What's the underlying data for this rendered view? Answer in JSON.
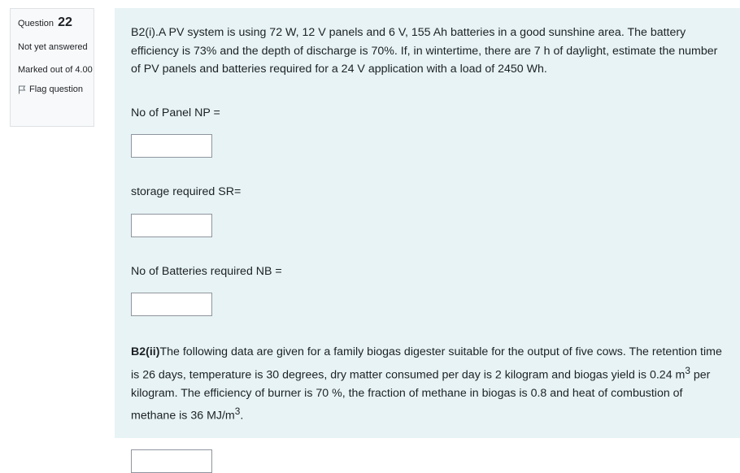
{
  "info": {
    "question_label": "Question",
    "question_number": "22",
    "state": "Not yet answered",
    "grade": "Marked out of 4.00",
    "flag_label": "Flag question"
  },
  "part1": {
    "text": "B2(i).A PV system is using 72 W, 12 V panels and 6 V, 155 Ah batteries in a good sunshine area. The battery efficiency is 73% and the depth of discharge is 70%. If, in wintertime, there are 7 h of daylight, estimate the number of PV panels and batteries required for a 24 V application with a load of 2450 Wh.",
    "fields": [
      {
        "label": "No of Panel NP =",
        "value": ""
      },
      {
        "label": "storage required SR=",
        "value": ""
      },
      {
        "label": "No of Batteries required NB =",
        "value": ""
      }
    ]
  },
  "part2": {
    "heading": "B2(ii)",
    "text_a": "The following data are given for a family biogas digester suitable for the output of five cows. The retention time is 26 days, temperature is 30 degrees, dry matter consumed per day is 2 kilogram and biogas yield is 0.24 m",
    "sup_a": "3",
    "text_b": " per kilogram. The efficiency of burner is 70 %, the fraction of methane in biogas is 0.8 and heat of combustion of methane is 36 MJ/m",
    "sup_b": "3",
    "text_c": ".",
    "answer_value": ""
  }
}
